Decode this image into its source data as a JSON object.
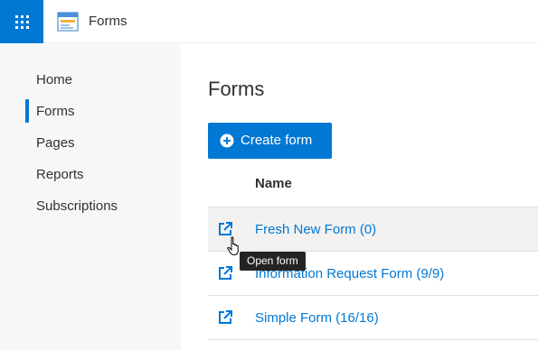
{
  "app": {
    "title": "Forms"
  },
  "sidebar": {
    "items": [
      {
        "label": "Home",
        "active": false
      },
      {
        "label": "Forms",
        "active": true
      },
      {
        "label": "Pages",
        "active": false
      },
      {
        "label": "Reports",
        "active": false
      },
      {
        "label": "Subscriptions",
        "active": false
      }
    ]
  },
  "main": {
    "title": "Forms",
    "create_button": "Create form",
    "column_name": "Name",
    "rows": [
      {
        "name": "Fresh New Form (0)",
        "hovered": true
      },
      {
        "name": "Information Request Form (9/9)",
        "hovered": false
      },
      {
        "name": "Simple Form (16/16)",
        "hovered": false
      }
    ],
    "tooltip": "Open form"
  },
  "colors": {
    "accent": "#0078d4",
    "sidebar_bg": "#f7f7f7",
    "hover_row": "#f3f2f1"
  },
  "icons": [
    "app-launcher-icon",
    "forms-app-icon",
    "add-circle-icon",
    "open-in-new-window-icon",
    "hand-pointer-cursor-icon"
  ]
}
